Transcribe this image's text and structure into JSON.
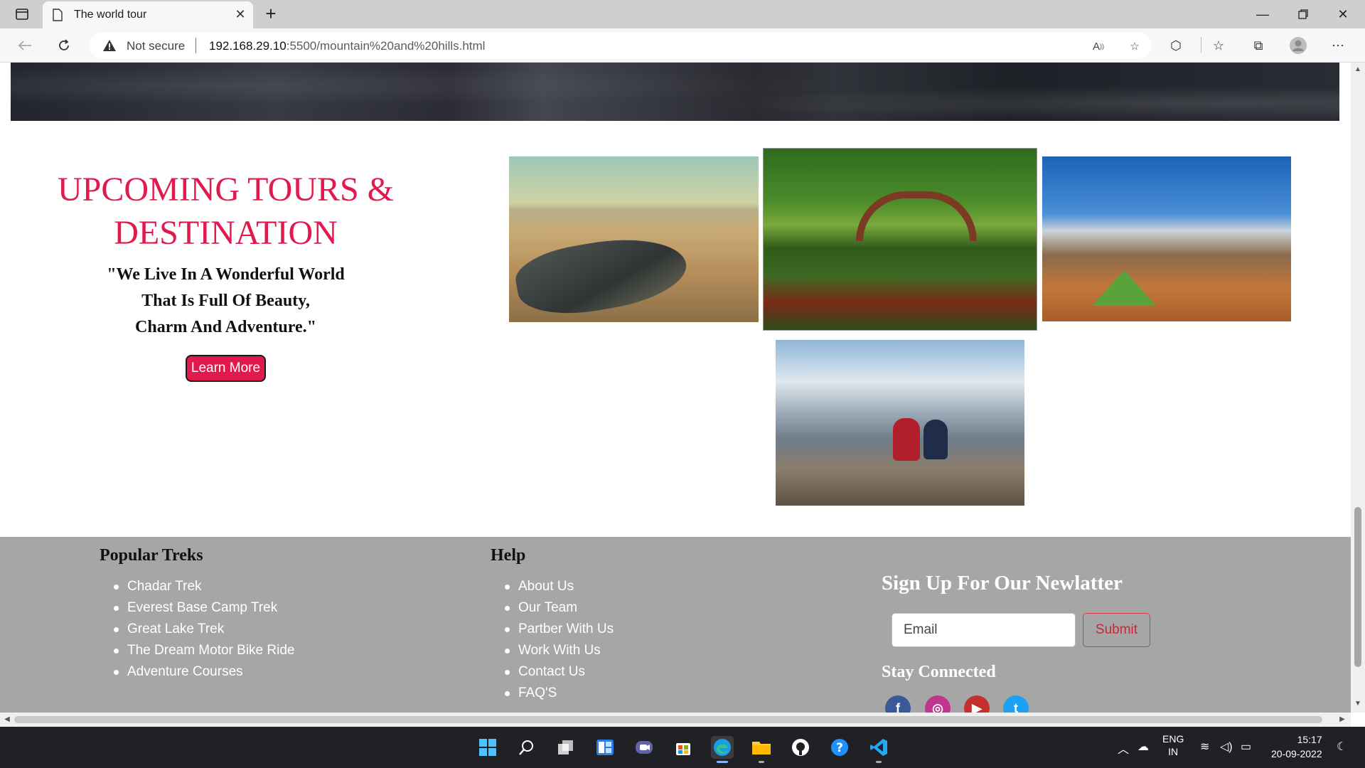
{
  "browser": {
    "tab_title": "The world tour",
    "not_secure": "Not secure",
    "url_host": "192.168.29.10",
    "url_rest": ":5500/mountain%20and%20hills.html"
  },
  "hero": {
    "title_line1": "UPCOMING TOURS &",
    "title_line2": "DESTINATION",
    "quote": "\"We Live In A Wonderful World\nThat Is Full Of Beauty,\nCharm And Adventure.\"",
    "button": "Learn More"
  },
  "footer": {
    "popular_heading": "Popular Treks",
    "popular_items": [
      "Chadar Trek",
      "Everest Base Camp Trek",
      "Great Lake Trek",
      "The Dream Motor Bike Ride",
      "Adventure Courses"
    ],
    "help_heading": "Help",
    "help_items": [
      "About Us",
      "Our Team",
      "Partber With Us",
      "Work With Us",
      "Contact Us",
      "FAQ'S"
    ],
    "signup_heading": "Sign Up For Our Newlatter",
    "email_placeholder": "Email",
    "submit_label": "Submit",
    "stay_heading": "Stay Connected",
    "social": [
      {
        "name": "facebook",
        "glyph": "f",
        "color": "#3b5998"
      },
      {
        "name": "instagram",
        "glyph": "◎",
        "color": "#c1358f"
      },
      {
        "name": "youtube",
        "glyph": "▶",
        "color": "#c4302b"
      },
      {
        "name": "twitter",
        "glyph": "t",
        "color": "#1da1f2"
      }
    ]
  },
  "taskbar": {
    "lang_line1": "ENG",
    "lang_line2": "IN",
    "time": "15:17",
    "date": "20-09-2022"
  }
}
